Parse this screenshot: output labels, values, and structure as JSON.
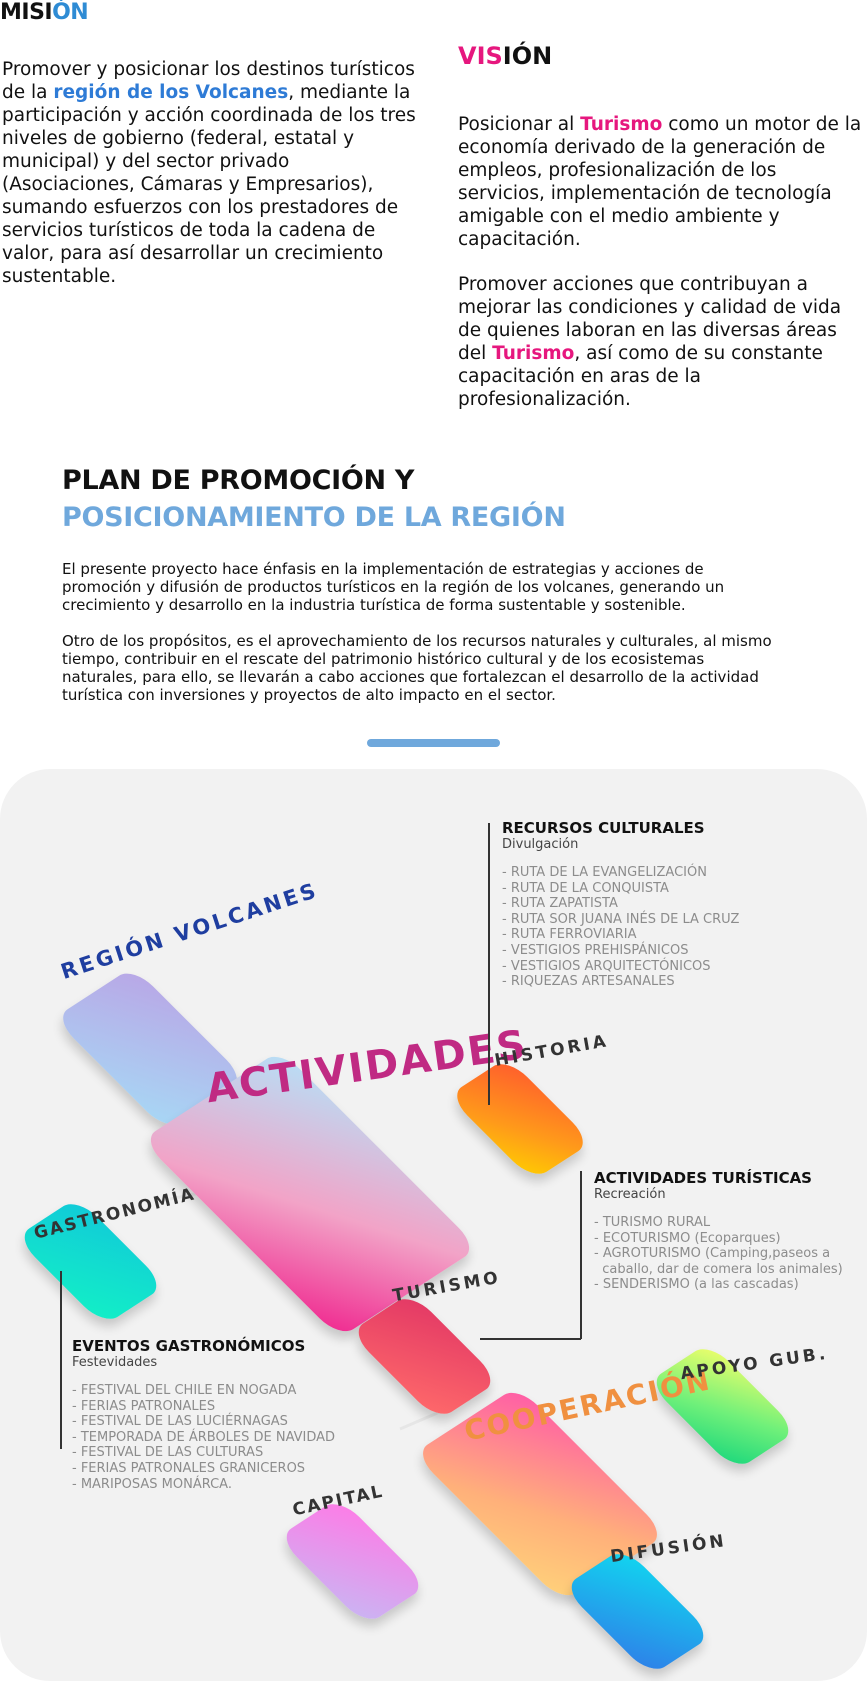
{
  "mision": {
    "title_a": "MISI",
    "title_b": "ÓN",
    "text_1": "Promover y posicionar los destinos turísticos de la ",
    "highlight": "región de los Volcanes",
    "text_2": ", mediante la participación y acción coordinada de los tres niveles de gobierno (federal, estatal y municipal) y del sector privado (Asociaciones, Cámaras y Empresarios), sumando esfuerzos con los prestadores de servicios turísticos de toda la cadena de valor, para así desarrollar un crecimiento sustentable."
  },
  "vision": {
    "title_a": "VIS",
    "title_b": "IÓN",
    "p1_a": "Posicionar al ",
    "p1_hl": "Turismo",
    "p1_b": " como un motor de la economía derivado de la generación de empleos, profesionalización de los servicios, implementación de tecnología amigable con el medio ambiente y capacitación.",
    "p2_a": "Promover acciones que contribuyan a mejorar las condiciones y calidad de vida de quienes laboran en las diversas áreas del ",
    "p2_hl": "Turismo",
    "p2_b": ", así como de su constante capacitación en aras de la profesionalización."
  },
  "plan": {
    "title_line1": "PLAN DE PROMOCIÓN Y",
    "title_line2": "POSICIONAMIENTO DE LA REGIÓN",
    "p1": "El presente proyecto hace énfasis en la implementación de estrategias y acciones de promoción y difusión de productos turísticos en la región de los volcanes, generando un crecimiento y desarrollo en la industria turística de forma sustentable y sostenible.",
    "p2": "Otro de los propósitos, es el aprovechamiento de los recursos naturales y culturales, al mismo tiempo, contribuir en el rescate del patrimonio histórico cultural y de los ecosistemas naturales, para ello, se llevarán a cabo acciones que fortalezcan el desarrollo de la actividad turística con inversiones y proyectos de alto impacto en el sector."
  },
  "diagram": {
    "labels": {
      "region": "REGIÓN VOLCANES",
      "actividades": "ACTIVIDADES",
      "historia": "HISTORIA",
      "gastronomia": "GASTRONOMÍA",
      "turismo": "TURISMO",
      "cooperacion": "COOPERACIÓN",
      "apoyo": "APOYO GUB.",
      "capital": "CAPITAL",
      "difusion": "DIFUSIÓN"
    },
    "recursos": {
      "title": "RECURSOS CULTURALES",
      "subtitle": "Divulgación",
      "items": "- RUTA DE LA EVANGELIZACIÓN\n- RUTA DE LA CONQUISTA\n- RUTA ZAPATISTA\n- RUTA SOR JUANA INÉS DE LA CRUZ\n- RUTA FERROVIARIA\n- VESTIGIOS PREHISPÁNICOS\n- VESTIGIOS ARQUITECTÓNICOS\n- RIQUEZAS ARTESANALES"
    },
    "actividades_info": {
      "title": "ACTIVIDADES TURÍSTICAS",
      "subtitle": "Recreación",
      "items": "- TURISMO RURAL\n- ECOTURISMO (Ecoparques)\n- AGROTURISMO (Camping,paseos a\n  caballo, dar de comera los animales)\n- SENDERISMO (a las cascadas)"
    },
    "eventos": {
      "title": "EVENTOS GASTRONÓMICOS",
      "subtitle": "Festevidades",
      "items": "- FESTIVAL DEL CHILE EN NOGADA\n- FERIAS PATRONALES\n- FESTIVAL DE LAS LUCIÉRNAGAS\n- TEMPORADA DE ÁRBOLES DE NAVIDAD\n- FESTIVAL DE LAS CULTURAS\n- FERIAS PATRONALES GRANICEROS\n- MARIPOSAS MONÁRCA."
    }
  }
}
